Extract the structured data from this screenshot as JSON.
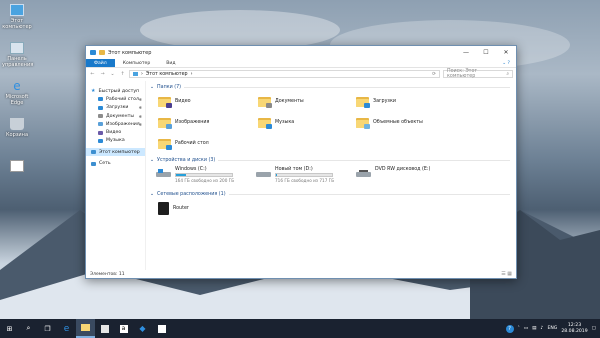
{
  "desktop": {
    "icons": [
      {
        "label": "Этот компьютер",
        "icon": "computer-icon"
      },
      {
        "label": "Панель управления",
        "icon": "control-panel-icon"
      },
      {
        "label": "Microsoft Edge",
        "icon": "edge-icon"
      },
      {
        "label": "Корзина",
        "icon": "recycle-bin-icon"
      },
      {
        "label": "",
        "icon": "shortcut-icon"
      }
    ]
  },
  "window": {
    "title": "Этот компьютер",
    "controls": {
      "minimize": "—",
      "maximize": "☐",
      "close": "✕"
    },
    "ribbon_tabs": [
      "Файл",
      "Компьютер",
      "Вид"
    ],
    "help": "⌄ ?",
    "address": {
      "path_root": "›",
      "path": "Этот компьютер",
      "chevron": "›"
    },
    "search_placeholder": "Поиск: Этот компьютер",
    "nav": [
      {
        "label": "Быстрый доступ",
        "level": 0,
        "color": "#2b8ad6"
      },
      {
        "label": "Рабочий стол",
        "level": 1,
        "pinned": true,
        "color": "#2b8ad6"
      },
      {
        "label": "Загрузки",
        "level": 1,
        "pinned": true,
        "color": "#2b8ad6"
      },
      {
        "label": "Документы",
        "level": 1,
        "pinned": true,
        "color": "#8c8c8c"
      },
      {
        "label": "Изображения",
        "level": 1,
        "pinned": true,
        "color": "#5aa0d8"
      },
      {
        "label": "Видео",
        "level": 1,
        "pinned": false,
        "color": "#6b5aa8"
      },
      {
        "label": "Музыка",
        "level": 1,
        "pinned": false,
        "color": "#2b8ad6"
      },
      {
        "label": "Этот компьютер",
        "level": 0,
        "selected": true,
        "color": "#3d8fd0"
      },
      {
        "label": "Сеть",
        "level": 0,
        "color": "#3d8fd0"
      }
    ],
    "groups": {
      "folders_header": "Папки (7)",
      "folders": [
        {
          "label": "Видео",
          "badge": "#4b3e8f"
        },
        {
          "label": "Документы",
          "badge": "#8a8a8a"
        },
        {
          "label": "Загрузки",
          "badge": "#2b8ad6"
        },
        {
          "label": "Изображения",
          "badge": "#5aa0d8"
        },
        {
          "label": "Музыка",
          "badge": "#2b8ad6"
        },
        {
          "label": "Объемные объекты",
          "badge": "#6fb3e0"
        },
        {
          "label": "Рабочий стол",
          "badge": "#2b8ad6"
        }
      ],
      "drives_header": "Устройства и диски (3)",
      "drives": [
        {
          "label": "Windows (C:)",
          "caption": "164 ГБ свободно из 200 ГБ",
          "used": 0.18,
          "has_bar": true
        },
        {
          "label": "Новый том (D:)",
          "caption": "716 ГБ свободно из 717 ГБ",
          "used": 0.01,
          "has_bar": true
        },
        {
          "label": "DVD RW дисковод (E:)",
          "caption": "",
          "has_bar": false
        }
      ],
      "network_header": "Сетевые расположения (1)",
      "network": [
        {
          "label": "Router"
        }
      ]
    },
    "status": "Элементов: 11"
  },
  "taskbar": {
    "start": "⊞",
    "search": "⌕",
    "taskview": "❐",
    "apps": [
      "edge-icon",
      "explorer-icon",
      "store-icon",
      "amazon-icon",
      "dropbox-icon",
      "app-icon"
    ],
    "tray": {
      "lang": "ENG",
      "time": "12:23",
      "date": "28.08.2019",
      "help": "?"
    }
  }
}
